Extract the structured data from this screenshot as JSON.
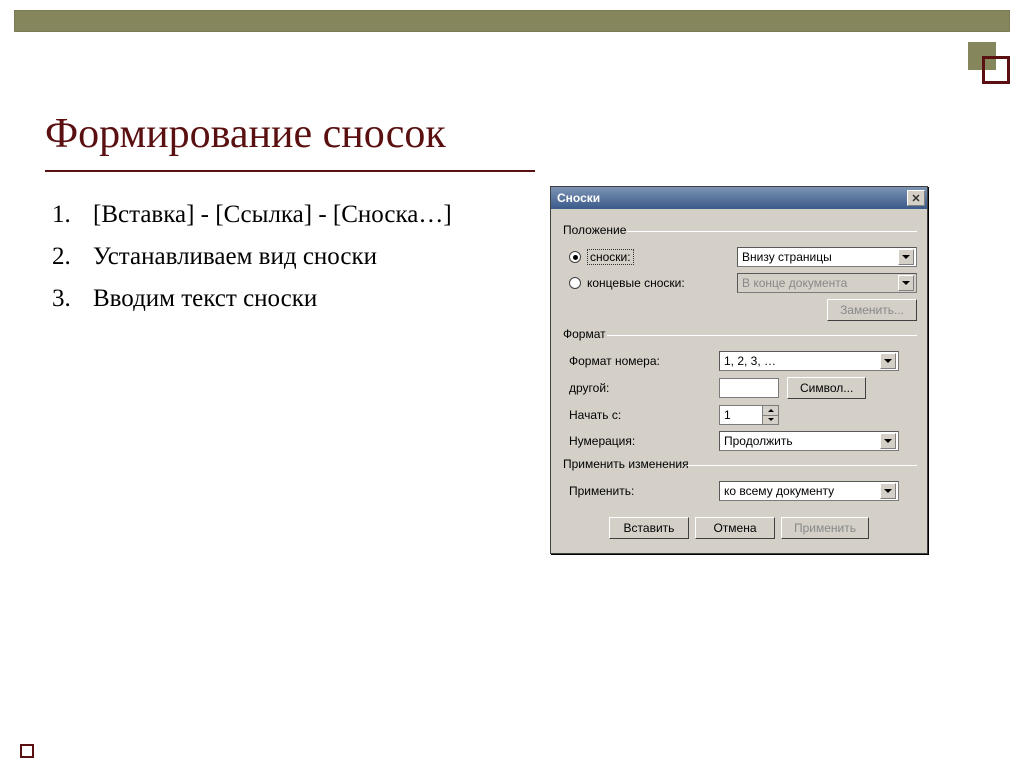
{
  "slide": {
    "title": "Формирование сносок",
    "items": [
      "[Вставка] - [Ссылка] - [Сноска…]",
      "Устанавливаем вид сноски",
      "Вводим текст сноски"
    ]
  },
  "dialog": {
    "title": "Сноски",
    "group_position": "Положение",
    "radio_footnotes": "сноски:",
    "radio_endnotes": "концевые сноски:",
    "footnotes_value": "Внизу страницы",
    "endnotes_value": "В конце документа",
    "btn_replace": "Заменить...",
    "group_format": "Формат",
    "lbl_number_format": "Формат номера:",
    "number_format_value": "1, 2, 3, …",
    "lbl_other": "другой:",
    "btn_symbol": "Символ...",
    "lbl_start_at": "Начать с:",
    "start_at_value": "1",
    "lbl_numbering": "Нумерация:",
    "numbering_value": "Продолжить",
    "group_apply": "Применить изменения",
    "lbl_apply_to": "Применить:",
    "apply_to_value": "ко всему документу",
    "btn_insert": "Вставить",
    "btn_cancel": "Отмена",
    "btn_apply": "Применить"
  }
}
